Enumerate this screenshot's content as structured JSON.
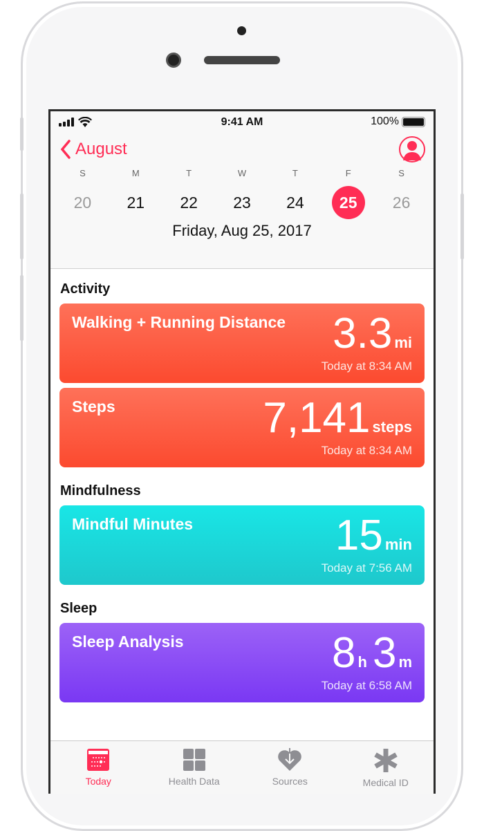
{
  "status": {
    "time": "9:41 AM",
    "battery": "100%"
  },
  "nav": {
    "back_label": "August"
  },
  "week": {
    "days": [
      {
        "dow": "S",
        "num": "20"
      },
      {
        "dow": "M",
        "num": "21"
      },
      {
        "dow": "T",
        "num": "22"
      },
      {
        "dow": "W",
        "num": "23"
      },
      {
        "dow": "T",
        "num": "24"
      },
      {
        "dow": "F",
        "num": "25"
      },
      {
        "dow": "S",
        "num": "26"
      }
    ],
    "selected": "25",
    "full_date": "Friday, Aug 25, 2017"
  },
  "sections": [
    {
      "title": "Activity",
      "cards": [
        {
          "title": "Walking + Running Distance",
          "value": "3.3",
          "unit": "mi",
          "time": "Today at 8:34 AM"
        },
        {
          "title": "Steps",
          "value": "7,141",
          "unit": "steps",
          "time": "Today at 8:34 AM"
        }
      ]
    },
    {
      "title": "Mindfulness",
      "cards": [
        {
          "title": "Mindful Minutes",
          "value": "15",
          "unit": "min",
          "time": "Today at 7:56 AM"
        }
      ]
    },
    {
      "title": "Sleep",
      "cards": [
        {
          "title": "Sleep Analysis",
          "value": "8",
          "unit": "h",
          "value2": "3",
          "unit2": "m",
          "time": "Today at 6:58 AM"
        }
      ]
    }
  ],
  "tabs": [
    {
      "label": "Today",
      "icon": "calendar-icon"
    },
    {
      "label": "Health Data",
      "icon": "grid-icon"
    },
    {
      "label": "Sources",
      "icon": "heart-download-icon"
    },
    {
      "label": "Medical ID",
      "icon": "asterisk-icon"
    }
  ],
  "colors": {
    "accent": "#ff2d55",
    "activity": "#fc4a2f",
    "mindfulness": "#1ec8cc",
    "sleep": "#7a38f3"
  }
}
